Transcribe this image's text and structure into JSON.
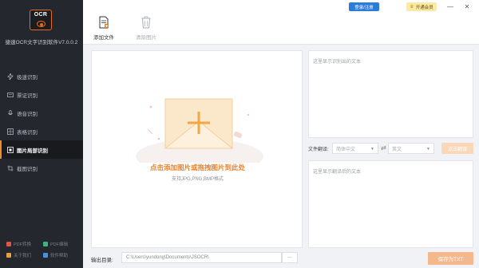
{
  "app": {
    "logo_text": "OCR",
    "title": "捷速OCR文字识别软件V7.0.0.2"
  },
  "sidebar": {
    "items": [
      {
        "label": "极速识别",
        "icon": "lightning-icon",
        "active": false
      },
      {
        "label": "票证识别",
        "icon": "ticket-icon",
        "active": false
      },
      {
        "label": "语音识别",
        "icon": "microphone-icon",
        "active": false
      },
      {
        "label": "表格识别",
        "icon": "table-icon",
        "active": false
      },
      {
        "label": "图片局部识别",
        "icon": "crop-icon",
        "active": true
      },
      {
        "label": "截图识别",
        "icon": "screenshot-icon",
        "active": false
      }
    ],
    "footer": [
      {
        "label": "PDF转换",
        "icon": "pdf-convert-icon",
        "color": "#e0524a"
      },
      {
        "label": "PDF编辑",
        "icon": "pdf-edit-icon",
        "color": "#3fb37f"
      },
      {
        "label": "关于我们",
        "icon": "about-icon",
        "color": "#e9a23b"
      },
      {
        "label": "软件帮助",
        "icon": "help-icon",
        "color": "#4a90e2"
      }
    ]
  },
  "toolbar": {
    "add_file": "添加文件",
    "clear_images": "清除图片"
  },
  "header": {
    "login": "登录/注册",
    "vip": "开通会员",
    "vip_icon": "♛",
    "minimize": "—",
    "close": "✕"
  },
  "drop_zone": {
    "main_text": "点击添加图片或拖拽图片到此处",
    "sub_text": "支持JPG,PNG,BMP格式"
  },
  "result": {
    "placeholder": "这里显示识别出的文本"
  },
  "translate": {
    "label": "文件翻译:",
    "source_lang": "简体中文",
    "target_lang": "英文",
    "swap": "⇄",
    "button": "点击翻译",
    "placeholder": "这里显示翻译后的文本"
  },
  "bottom": {
    "output_label": "输出目录:",
    "output_path": "C:\\Users\\yundong\\Documents\\JSOCR\\",
    "browse": "···",
    "save": "保存为TXT"
  },
  "colors": {
    "accent": "#e9822b",
    "sidebar_bg": "#24272d",
    "login_blue": "#2b7bdb",
    "vip_yellow": "#fbe9a8"
  }
}
